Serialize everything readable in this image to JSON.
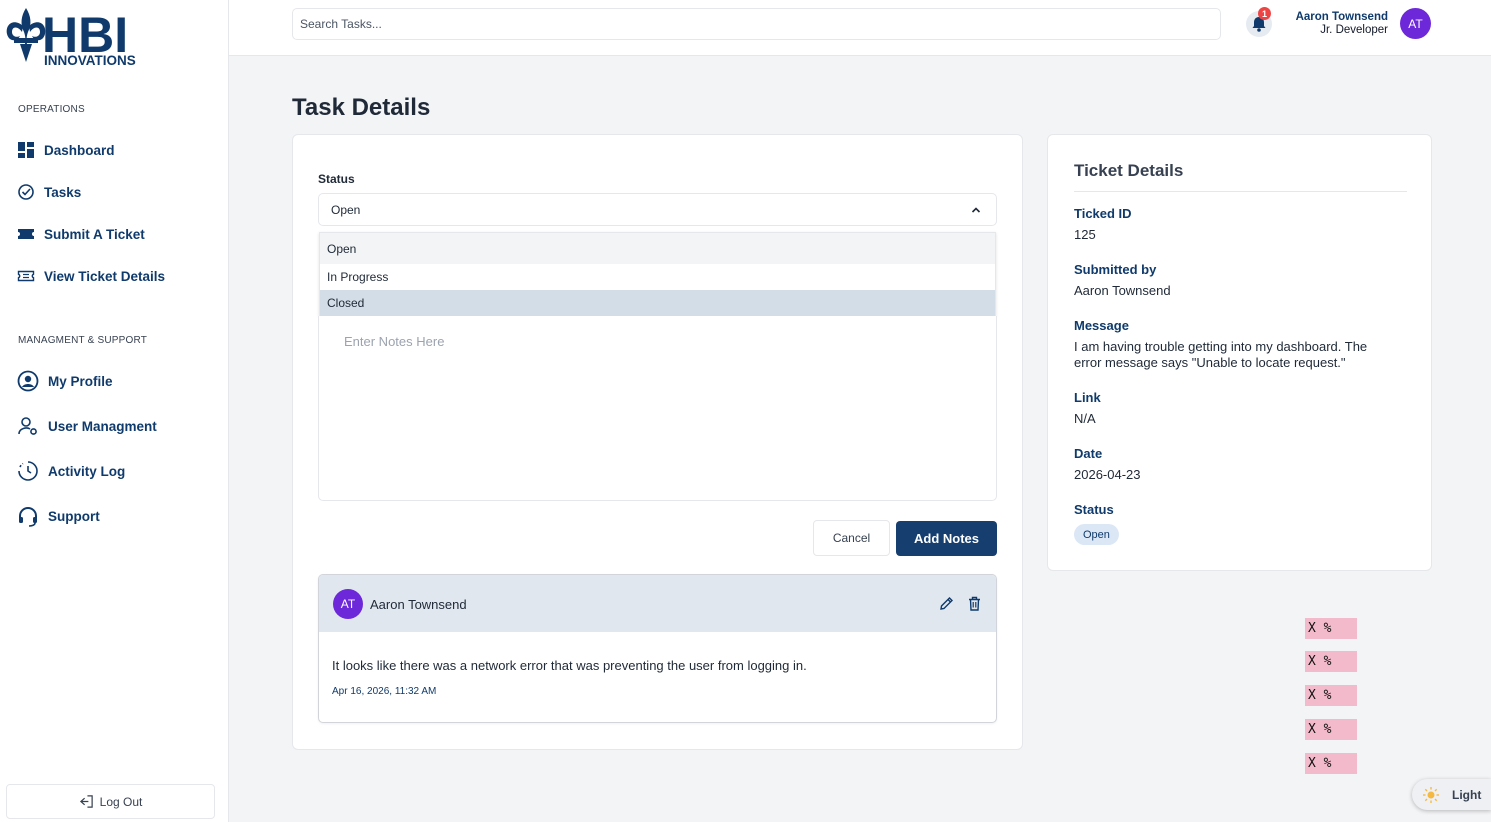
{
  "brand": {
    "logo_text": "HBI",
    "logo_sub": "INNOVATIONS"
  },
  "sidebar": {
    "operations_label": "OPERATIONS",
    "operations": [
      {
        "label": "Dashboard",
        "icon": "dashboard-icon"
      },
      {
        "label": "Tasks",
        "icon": "check-circle-icon"
      },
      {
        "label": "Submit A Ticket",
        "icon": "ticket-icon"
      },
      {
        "label": "View Ticket Details",
        "icon": "ticket-outline-icon"
      }
    ],
    "management_label": "MANAGMENT & SUPPORT",
    "management": [
      {
        "label": "My Profile",
        "icon": "user-circle-icon"
      },
      {
        "label": "User Managment",
        "icon": "user-gear-icon"
      },
      {
        "label": "Activity Log",
        "icon": "clock-icon"
      },
      {
        "label": "Support",
        "icon": "headset-icon"
      }
    ],
    "logout_label": "Log Out"
  },
  "topbar": {
    "search_placeholder": "Search Tasks...",
    "notification_count": "1",
    "user_name": "Aaron Townsend",
    "user_role": "Jr. Developer",
    "avatar_initials": "AT"
  },
  "main": {
    "title": "Task Details",
    "status_label": "Status",
    "status_value": "Open",
    "status_options": [
      "Open",
      "In Progress",
      "Closed"
    ],
    "notes_placeholder": "Enter Notes Here",
    "cancel_label": "Cancel",
    "add_notes_label": "Add Notes",
    "note": {
      "initials": "AT",
      "author": "Aaron Townsend",
      "text": "It looks like there was a network error that was preventing the user from logging in.",
      "date": "Apr 16, 2026, 11:32 AM"
    }
  },
  "ticket": {
    "title": "Ticket Details",
    "id_label": "Ticked ID",
    "id_value": "125",
    "submitted_label": "Submitted by",
    "submitted_value": "Aaron Townsend",
    "message_label": "Message",
    "message_value": "I am having trouble getting into my dashboard. The error message says \"Unable to locate request.\"",
    "link_label": "Link",
    "link_value": "N/A",
    "date_label": "Date",
    "date_value": "2026-04-23",
    "status_label": "Status",
    "status_value": "Open"
  },
  "tags": [
    "X %",
    "X %",
    "X %",
    "X %",
    "X %"
  ],
  "theme_label": "Light",
  "colors": {
    "brand_navy": "#0f3a6b",
    "button": "#163f70",
    "avatar": "#6d28d9",
    "badge_red": "#ef4444"
  }
}
